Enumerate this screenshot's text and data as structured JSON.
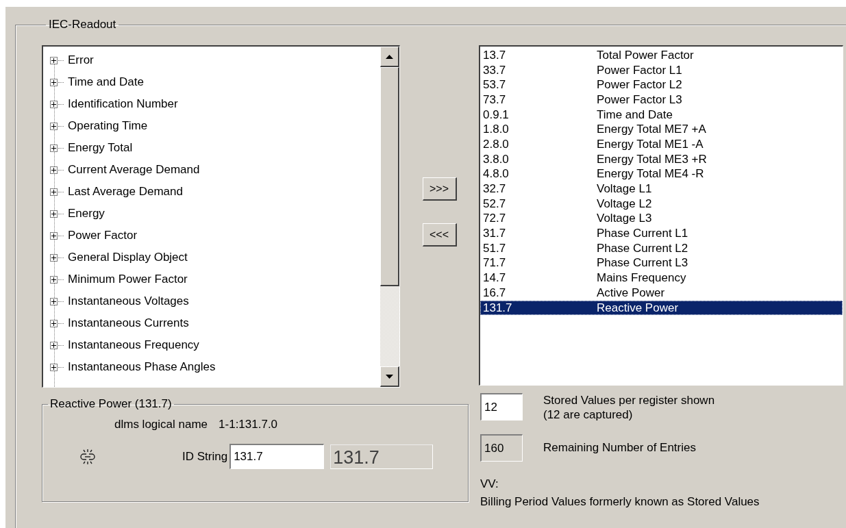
{
  "group": {
    "title": "IEC-Readout"
  },
  "tree": {
    "items": [
      {
        "label": "Error",
        "expanded": false
      },
      {
        "label": "Time and Date",
        "expanded": false
      },
      {
        "label": "Identification Number",
        "expanded": false
      },
      {
        "label": "Operating Time",
        "expanded": false
      },
      {
        "label": "Energy Total",
        "expanded": false
      },
      {
        "label": "Current Average Demand",
        "expanded": false
      },
      {
        "label": "Last Average Demand",
        "expanded": false
      },
      {
        "label": "Energy",
        "expanded": false
      },
      {
        "label": "Power Factor",
        "expanded": false
      },
      {
        "label": "General Display Object",
        "expanded": false
      },
      {
        "label": "Minimum Power Factor",
        "expanded": false
      },
      {
        "label": "Instantaneous Voltages",
        "expanded": false
      },
      {
        "label": "Instantaneous Currents",
        "expanded": false
      },
      {
        "label": "Instantaneous Frequency",
        "expanded": false
      },
      {
        "label": "Instantaneous Phase Angles",
        "expanded": false
      }
    ]
  },
  "move_buttons": [
    ">>>",
    "<<<"
  ],
  "register_list": {
    "rows": [
      {
        "code": "13.7",
        "name": "Total Power Factor",
        "selected": false
      },
      {
        "code": "33.7",
        "name": "Power Factor L1",
        "selected": false
      },
      {
        "code": "53.7",
        "name": "Power Factor L2",
        "selected": false
      },
      {
        "code": "73.7",
        "name": "Power Factor L3",
        "selected": false
      },
      {
        "code": "0.9.1",
        "name": "Time and Date",
        "selected": false
      },
      {
        "code": "1.8.0",
        "name": "Energy Total ME7 +A",
        "selected": false
      },
      {
        "code": "2.8.0",
        "name": "Energy Total ME1 -A",
        "selected": false
      },
      {
        "code": "3.8.0",
        "name": "Energy Total ME3 +R",
        "selected": false
      },
      {
        "code": "4.8.0",
        "name": "Energy Total ME4 -R",
        "selected": false
      },
      {
        "code": "32.7",
        "name": "Voltage L1",
        "selected": false
      },
      {
        "code": "52.7",
        "name": "Voltage L2",
        "selected": false
      },
      {
        "code": "72.7",
        "name": "Voltage L3",
        "selected": false
      },
      {
        "code": "31.7",
        "name": "Phase Current L1",
        "selected": false
      },
      {
        "code": "51.7",
        "name": "Phase Current L2",
        "selected": false
      },
      {
        "code": "71.7",
        "name": "Phase Current L3",
        "selected": false
      },
      {
        "code": "14.7",
        "name": "Mains Frequency",
        "selected": false
      },
      {
        "code": "16.7",
        "name": "Active Power",
        "selected": false
      },
      {
        "code": "131.7",
        "name": "Reactive Power",
        "selected": true
      }
    ]
  },
  "details": {
    "title": "Reactive Power (131.7)",
    "logical_name_label": "dlms logical name",
    "logical_name": "1-1:131.7.0",
    "id_string_label": "ID String",
    "id_string_value": "131.7",
    "id_string_display": "131.7"
  },
  "stored_values": {
    "value": "12",
    "label": "Stored Values per register shown",
    "note": "(12 are captured)"
  },
  "remaining": {
    "value": "160",
    "label": "Remaining Number of Entries"
  },
  "footnote": {
    "title": "VV:",
    "text": "Billing Period Values formerly known as Stored Values"
  }
}
